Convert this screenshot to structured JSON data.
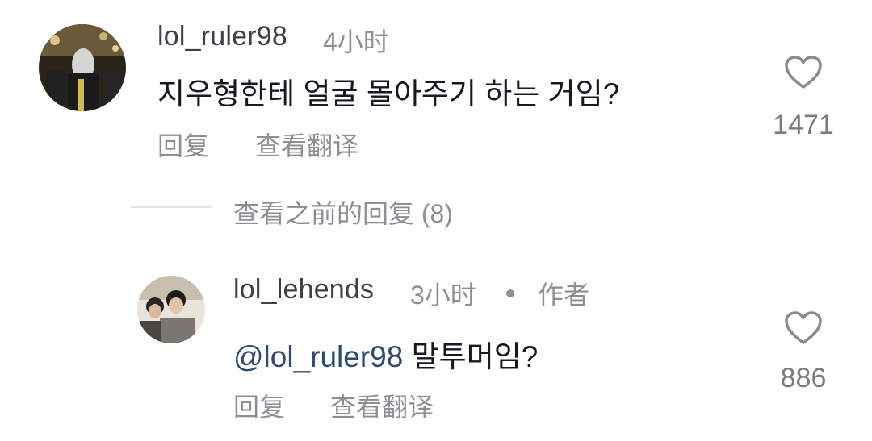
{
  "comment": {
    "username": "lol_ruler98",
    "time": "4小时",
    "text": "지우형한테 얼굴 몰아주기 하는 거임?",
    "reply_label": "回复",
    "translate_label": "查看翻译",
    "like_count": "1471",
    "avatar_icon": "user-avatar-photo"
  },
  "previous_replies": {
    "label": "查看之前的回复 (8)"
  },
  "reply": {
    "username": "lol_lehends",
    "time": "3小时",
    "author_badge": "作者",
    "mention": "@lol_ruler98",
    "text": " 말투머임?",
    "reply_label": "回复",
    "translate_label": "查看翻译",
    "like_count": "886",
    "avatar_icon": "user-avatar-photo"
  },
  "colors": {
    "mention": "#2f4b73",
    "secondary_text": "#8e8e93",
    "primary_text": "#161823"
  }
}
